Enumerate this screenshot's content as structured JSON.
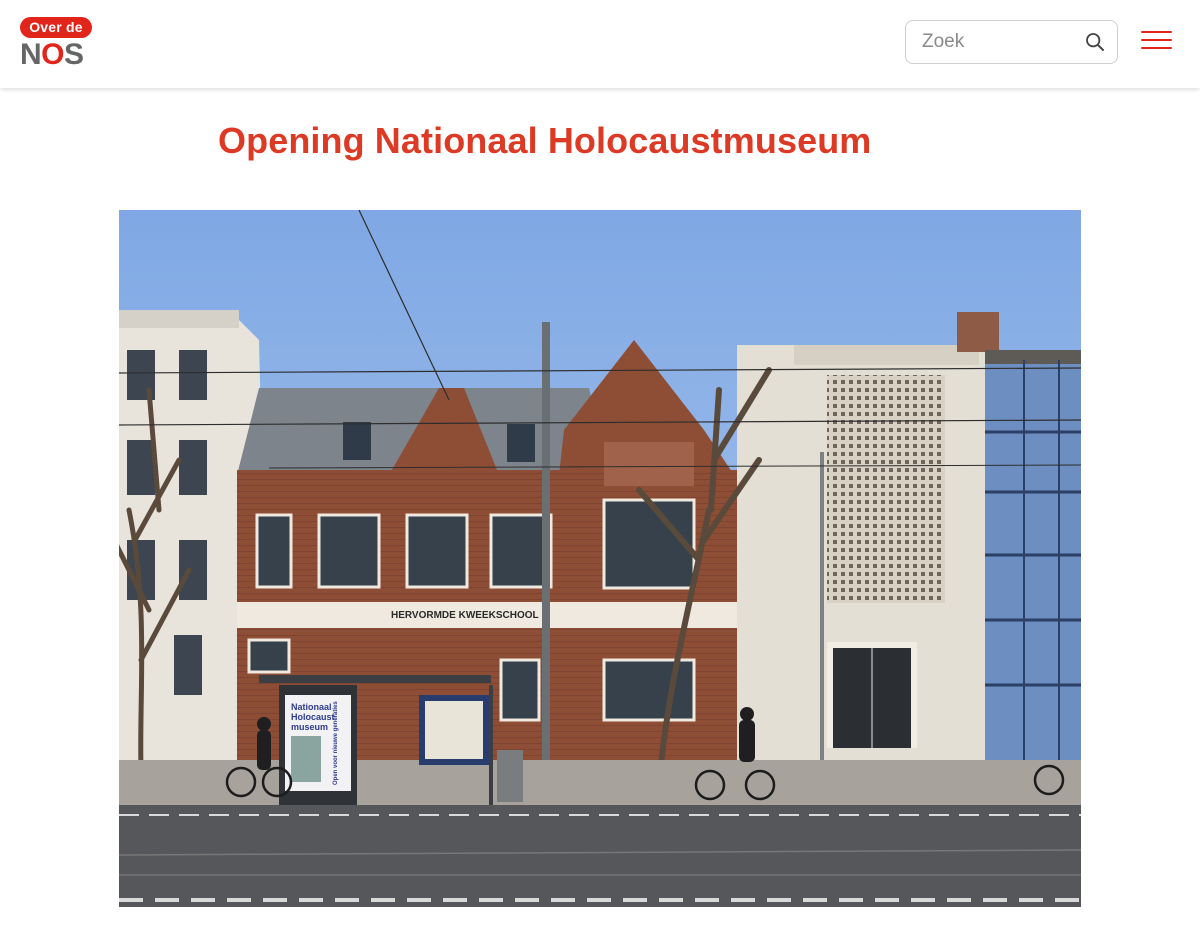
{
  "header": {
    "logo": {
      "pill_text": "Over de",
      "mark_n": "N",
      "mark_o": "O",
      "mark_s": "S"
    },
    "search": {
      "placeholder": "Zoek",
      "value": "",
      "icon": "search-icon"
    },
    "menu_icon": "hamburger-menu-icon"
  },
  "article": {
    "title": "Opening Nationaal Holocaustmuseum",
    "hero_image": {
      "building_sign": "HERVORMDE KWEEKSCHOOL",
      "poster_line1": "Nationaal",
      "poster_line2": "Holocaust",
      "poster_line3": "museum",
      "poster_tagline": "Open voor nieuwe generaties"
    }
  },
  "colors": {
    "brand_red": "#e1251b",
    "title_red": "#dd3a25",
    "logo_grey": "#666666"
  }
}
